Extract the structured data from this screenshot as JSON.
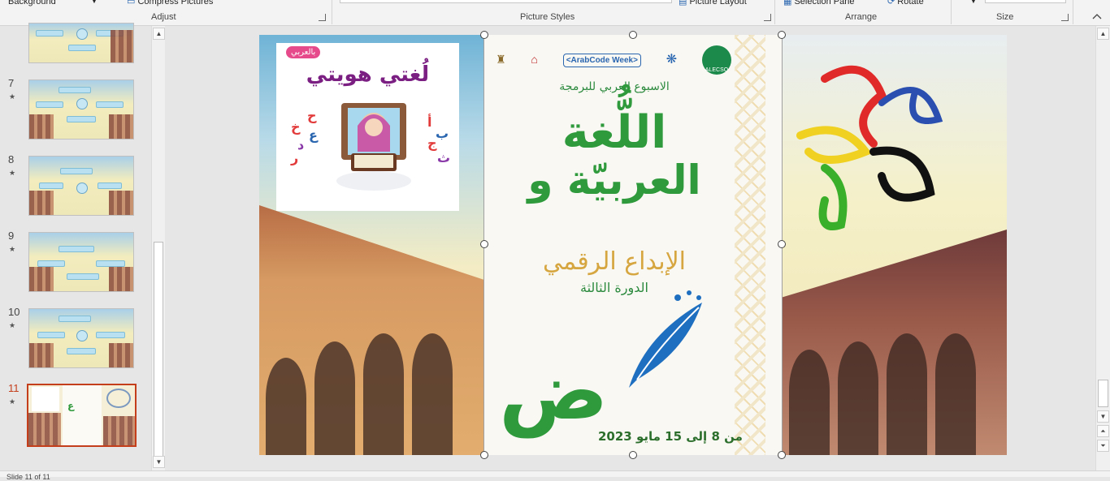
{
  "ribbon": {
    "background_label": "Background",
    "compress_label": "Compress Pictures",
    "picture_layout_label": "Picture Layout",
    "selection_pane_label": "Selection Pane",
    "rotate_label": "Rotate",
    "groups": {
      "adjust": "Adjust",
      "picture_styles": "Picture Styles",
      "arrange": "Arrange",
      "size": "Size"
    }
  },
  "slides": [
    {
      "number": "",
      "star": ""
    },
    {
      "number": "7",
      "star": "★"
    },
    {
      "number": "8",
      "star": "★"
    },
    {
      "number": "9",
      "star": "★"
    },
    {
      "number": "10",
      "star": "★"
    },
    {
      "number": "11",
      "star": "★"
    }
  ],
  "slide": {
    "card": {
      "logo_text": "بالعربي",
      "title": "لُغتي هويتي",
      "letters": [
        "أ",
        "ب",
        "ج",
        "ث",
        "ح",
        "خ",
        "ع",
        "د",
        "ر"
      ]
    },
    "poster": {
      "week": "الاسبوع العربي للبرمجة",
      "arabcode": "<ArabCode Week>",
      "alecso": "ALECSO",
      "headline1": "اللُّغة",
      "headline2": "العربيّة و",
      "subtitle": "الإبداع الرقمي",
      "edition": "الدورة الثالثة",
      "dates": "من 8 إلى 15 مايو 2023",
      "letter": "ض"
    }
  },
  "statusbar": {
    "slide_info": "Slide 11 of 11"
  },
  "colors": {
    "active_slide": "#c43e1c",
    "poster_green": "#2f9a3c",
    "poster_gold": "#d6a640",
    "card_title": "#7b1f83"
  }
}
